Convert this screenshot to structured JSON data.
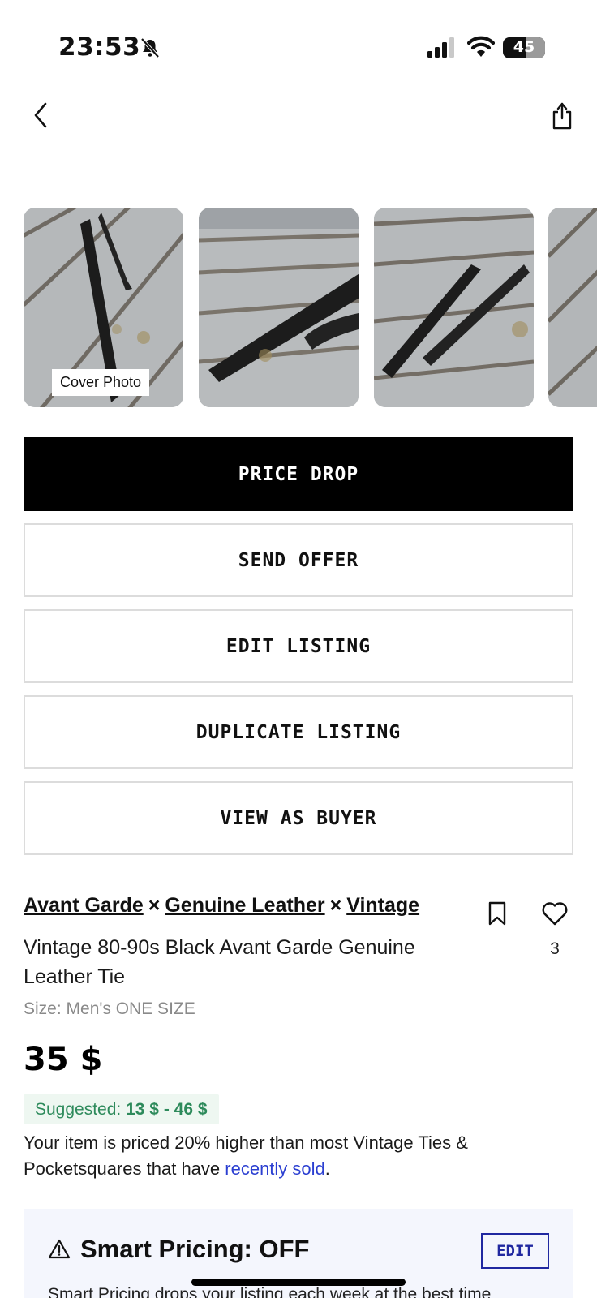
{
  "status": {
    "time": "23:53",
    "battery": "45",
    "battery_level": 0.45
  },
  "nav": {
    "back_icon": "chevron-left-icon",
    "share_icon": "share-icon"
  },
  "photos": {
    "cover_label": "Cover Photo",
    "count_visible": 4
  },
  "actions": {
    "price_drop": "PRICE DROP",
    "send_offer": "SEND OFFER",
    "edit_listing": "EDIT LISTING",
    "duplicate_listing": "DUPLICATE LISTING",
    "view_as_buyer": "VIEW AS BUYER"
  },
  "listing": {
    "designers": [
      "Avant Garde",
      "Genuine Leather",
      "Vintage"
    ],
    "separator": "×",
    "title": "Vintage 80-90s Black Avant Garde Genuine Leather Tie",
    "size": "Size: Men's ONE SIZE",
    "price": "35 $",
    "likes": "3"
  },
  "suggested": {
    "label": "Suggested:",
    "range": "13 $ - 46 $"
  },
  "note": {
    "text_before": "Your item is priced 20% higher than most Vintage Ties & Pocketsquares that have ",
    "link": "recently sold",
    "text_after": "."
  },
  "smart_pricing": {
    "title": "Smart Pricing: OFF",
    "edit": "EDIT",
    "desc": "Smart Pricing drops your listing each week at the best time"
  },
  "colors": {
    "primary": "#000000",
    "green": "#2d8a5b",
    "link": "#2b3fd1",
    "smart_bg": "#f4f6fd"
  }
}
